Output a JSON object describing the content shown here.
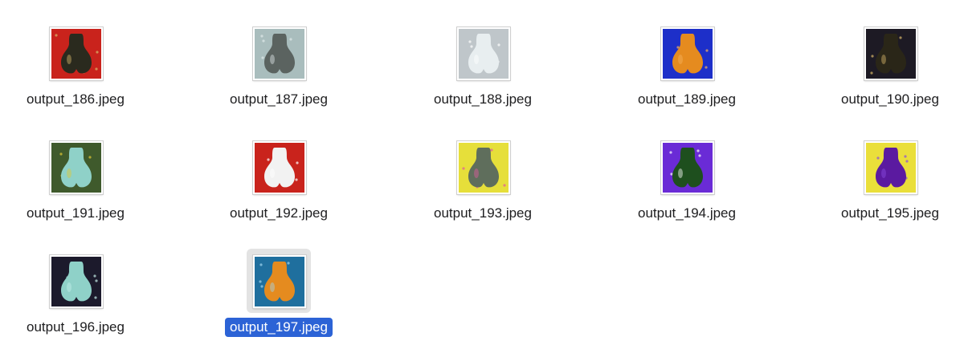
{
  "files": [
    {
      "name": "output_186.jpeg",
      "bg": "#c9231c",
      "obj": "#2a2a1e",
      "accent": "#d8b86a",
      "obj_icon": "black-gold-patterned-sack-image",
      "selected": false
    },
    {
      "name": "output_187.jpeg",
      "bg": "#a9bdbd",
      "obj": "#5b6360",
      "accent": "#dfe9ea",
      "obj_icon": "grey-sack-with-bubbles-image",
      "selected": false
    },
    {
      "name": "output_188.jpeg",
      "bg": "#bfc6ca",
      "obj": "#e8eef0",
      "accent": "#ffffff",
      "obj_icon": "white-fluffy-sack-image",
      "selected": false
    },
    {
      "name": "output_189.jpeg",
      "bg": "#1d2fc9",
      "obj": "#e58b1f",
      "accent": "#f5b15a",
      "obj_icon": "orange-sack-on-blue-image",
      "selected": false
    },
    {
      "name": "output_190.jpeg",
      "bg": "#1d1a24",
      "obj": "#2a2618",
      "accent": "#d8b86a",
      "obj_icon": "black-gold-sack-on-dark-image",
      "selected": false
    },
    {
      "name": "output_191.jpeg",
      "bg": "#3f5a2c",
      "obj": "#8fd1c8",
      "accent": "#e3c733",
      "obj_icon": "teal-fluffy-sack-flowers-image",
      "selected": false
    },
    {
      "name": "output_192.jpeg",
      "bg": "#c9231c",
      "obj": "#f2f2f2",
      "accent": "#ffffff",
      "obj_icon": "white-sack-on-red-image",
      "selected": false
    },
    {
      "name": "output_193.jpeg",
      "bg": "#e6df3a",
      "obj": "#5f6e5c",
      "accent": "#e05aa0",
      "obj_icon": "grey-sack-confetti-image",
      "selected": false
    },
    {
      "name": "output_194.jpeg",
      "bg": "#6a2bd6",
      "obj": "#1e4f1e",
      "accent": "#ffffff",
      "obj_icon": "green-sack-lightning-image",
      "selected": false
    },
    {
      "name": "output_195.jpeg",
      "bg": "#eadf3a",
      "obj": "#5b1aa0",
      "accent": "#8a4be0",
      "obj_icon": "purple-sack-on-yellow-image",
      "selected": false
    },
    {
      "name": "output_196.jpeg",
      "bg": "#1c1a2c",
      "obj": "#8fd1c8",
      "accent": "#c6f0ea",
      "obj_icon": "teal-fluffy-sack-dark-image",
      "selected": false
    },
    {
      "name": "output_197.jpeg",
      "bg": "#1f6f9e",
      "obj": "#e58b1f",
      "accent": "#9fd6f0",
      "obj_icon": "orange-sack-underwater-image",
      "selected": true
    }
  ],
  "colors": {
    "selection_label_bg": "#2c63d6",
    "selection_thumb_bg": "#e3e3e3"
  }
}
